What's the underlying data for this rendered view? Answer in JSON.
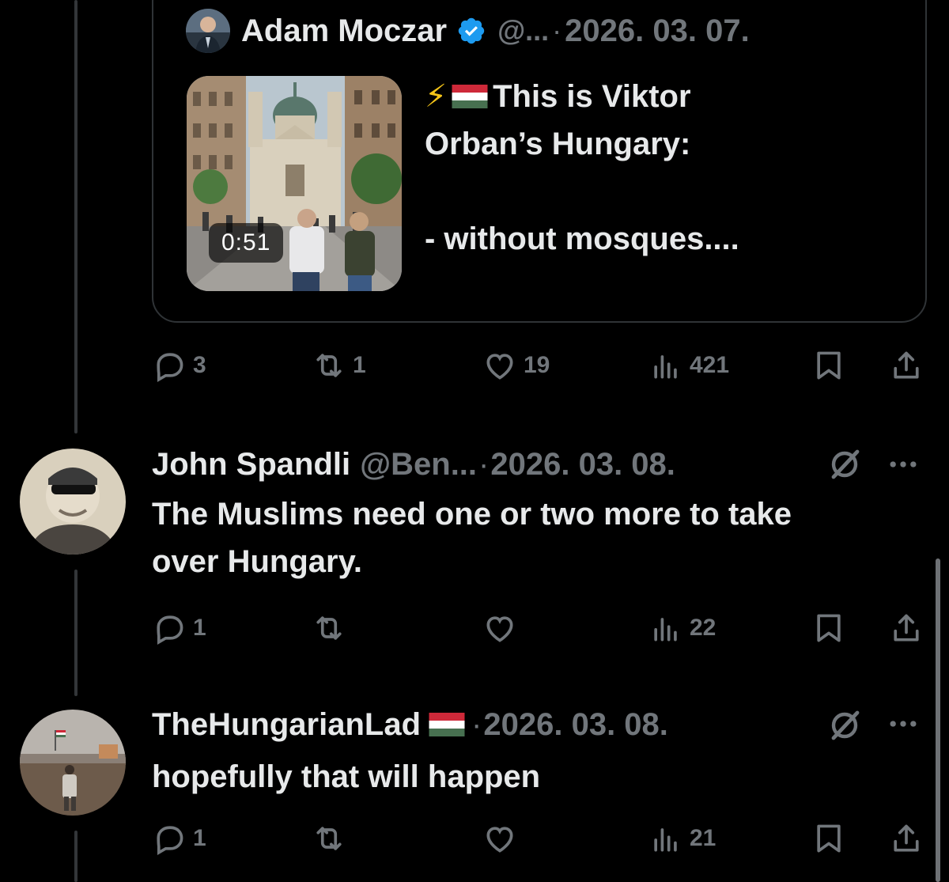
{
  "quoted_post": {
    "author_name": "Adam Moczar",
    "handle": "@...",
    "separator": "·",
    "date": "2026. 03. 07.",
    "video_duration": "0:51",
    "text_line1": "This is Viktor",
    "text_rest": "Orban’s Hungary:\n\n- without mosques....",
    "lightning_glyph": "⚡",
    "verified_color": "#1d9bf0"
  },
  "quoted_actions": {
    "replies": "3",
    "reposts": "1",
    "likes": "19",
    "views": "421"
  },
  "replies": [
    {
      "author_name": "John Spandli",
      "handle": "@Ben...",
      "separator": "·",
      "date": "2026. 03. 08.",
      "text": "The Muslims need one or two more to take over Hungary.",
      "actions": {
        "replies": "1",
        "reposts": "",
        "likes": "",
        "views": "22"
      }
    },
    {
      "author_name": "TheHungarianLad",
      "separator": "·",
      "date": "2026. 03. 08.",
      "text": "hopefully that will happen",
      "actions": {
        "replies": "1",
        "reposts": "",
        "likes": "",
        "views": "21"
      }
    }
  ],
  "colors": {
    "background": "#000000",
    "text_primary": "#e7e9ea",
    "text_secondary": "#71767b",
    "border": "#2f3336"
  }
}
